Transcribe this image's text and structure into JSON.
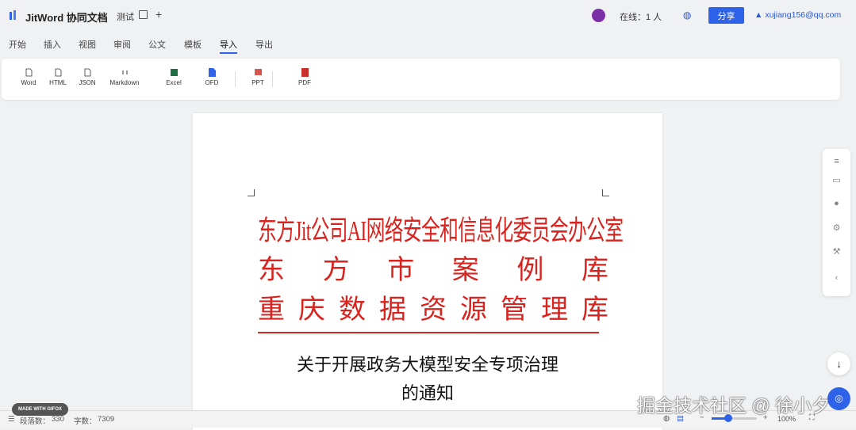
{
  "header": {
    "app_title": "JitWord 协同文档",
    "doc_title": "测试",
    "online": "在线：1 人",
    "share_label": "分享",
    "user_email": "xujiang156@qq.com"
  },
  "tabs": [
    "开始",
    "插入",
    "视图",
    "审阅",
    "公文",
    "模板",
    "导入",
    "导出"
  ],
  "active_tab": "导入",
  "toolbar": {
    "items": [
      "Word",
      "HTML",
      "JSON",
      "Markdown",
      "Excel",
      "OFD",
      "PPT",
      "PDF"
    ]
  },
  "document": {
    "red_header": [
      "东方Jit公司AI网络安全和信息化委员会办公室",
      "东方市案例库",
      "重庆数据资源管理库"
    ],
    "title_lines": [
      "关于开展政务大模型安全专项治理",
      "的通知"
    ]
  },
  "status": {
    "paragraphs_label": "段落数：",
    "paragraphs": "330",
    "words_label": "字数：",
    "words": "7309",
    "zoom": "100%"
  },
  "badge": "MADE WITH GIFOX",
  "watermark": "掘金技术社区 @ 徐小夕",
  "colors": {
    "accent": "#2e62e8",
    "red": "#d8231e"
  }
}
